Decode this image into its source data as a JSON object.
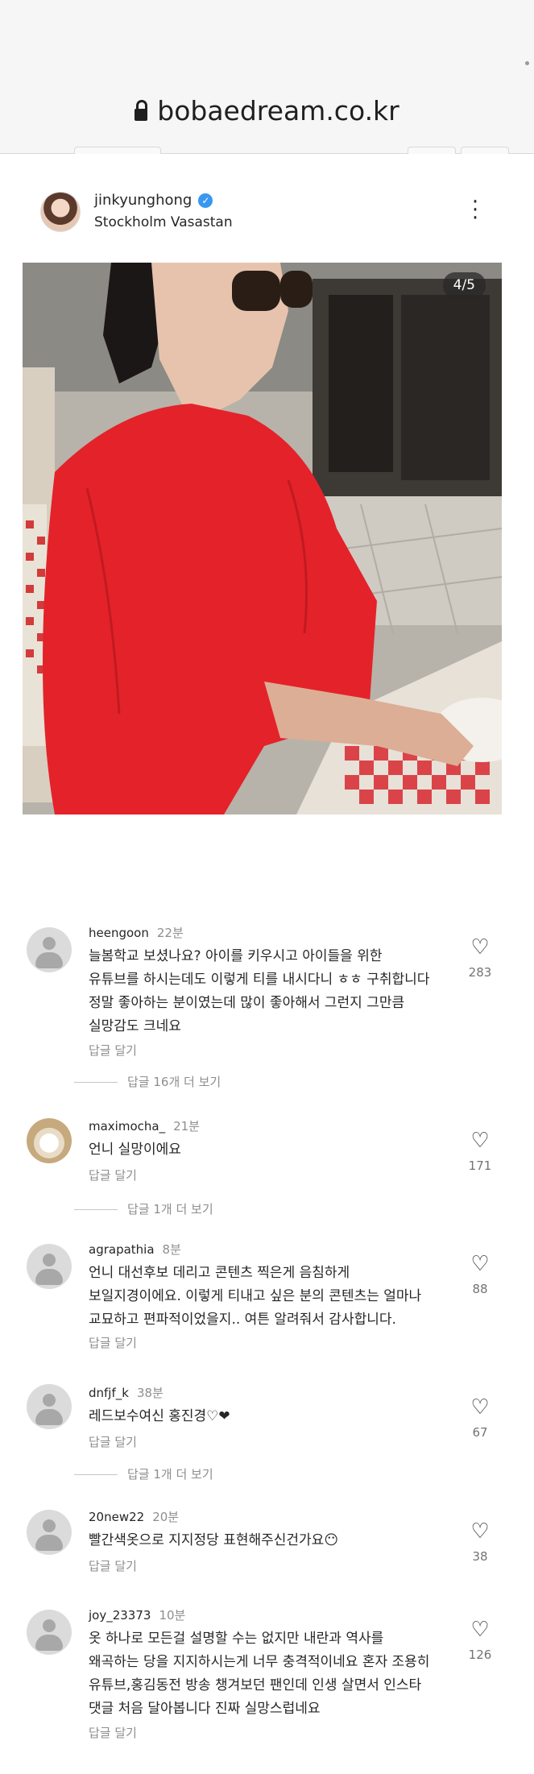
{
  "browser": {
    "url": "bobaedream.co.kr"
  },
  "post": {
    "username": "jinkyunghong",
    "location": "Stockholm Vasastan",
    "image_counter": "4/5",
    "more_icon": "more-vertical-icon"
  },
  "comments": [
    {
      "user": "heengoon",
      "time": "22분",
      "lines": [
        "늘봄학교 보셨나요? 아이를 키우시고 아이들을 위한",
        "유튜브를 하시는데도 이렇게 티를 내시다니 ㅎㅎ 구취합니다",
        "정말 좋아하는 분이였는데 많이 좋아해서 그런지 그만큼",
        "실망감도 크네요"
      ],
      "reply": "답글 달기",
      "likes": "283",
      "view_more": "답글 16개 더 보기"
    },
    {
      "user": "maximocha_",
      "time": "21분",
      "lines": [
        "언니 실망이에요"
      ],
      "reply": "답글 달기",
      "likes": "171",
      "view_more": "답글 1개 더 보기"
    },
    {
      "user": "agrapathia",
      "time": "8분",
      "lines": [
        "언니 대선후보 데리고 콘텐츠 찍은게 음침하게",
        "보일지경이에요. 이렇게 티내고 싶은 분의 콘텐츠는 얼마나",
        "교묘하고 편파적이었을지.. 여튼 알려줘서 감사합니다."
      ],
      "reply": "답글 달기",
      "likes": "88"
    },
    {
      "user": "dnfjf_k",
      "time": "38분",
      "lines": [
        "레드보수여신 홍진경♡❤"
      ],
      "reply": "답글 달기",
      "likes": "67",
      "view_more": "답글 1개 더 보기"
    },
    {
      "user": "20new22",
      "time": "20분",
      "lines": [
        "빨간색옷으로 지지정당 표현해주신건가요😶"
      ],
      "reply": "답글 달기",
      "likes": "38"
    },
    {
      "user": "joy_23373",
      "time": "10분",
      "lines": [
        "옷 하나로 모든걸 설명할 수는 없지만 내란과 역사를",
        "왜곡하는 당을 지지하시는게 너무 충격적이네요 혼자 조용히",
        "유튜브,홍김동전 방송 챙겨보던 팬인데 인생 살면서 인스타",
        "댓글 처음 달아봅니다 진짜 실망스럽네요"
      ],
      "reply": "답글 달기",
      "likes": "126"
    }
  ]
}
